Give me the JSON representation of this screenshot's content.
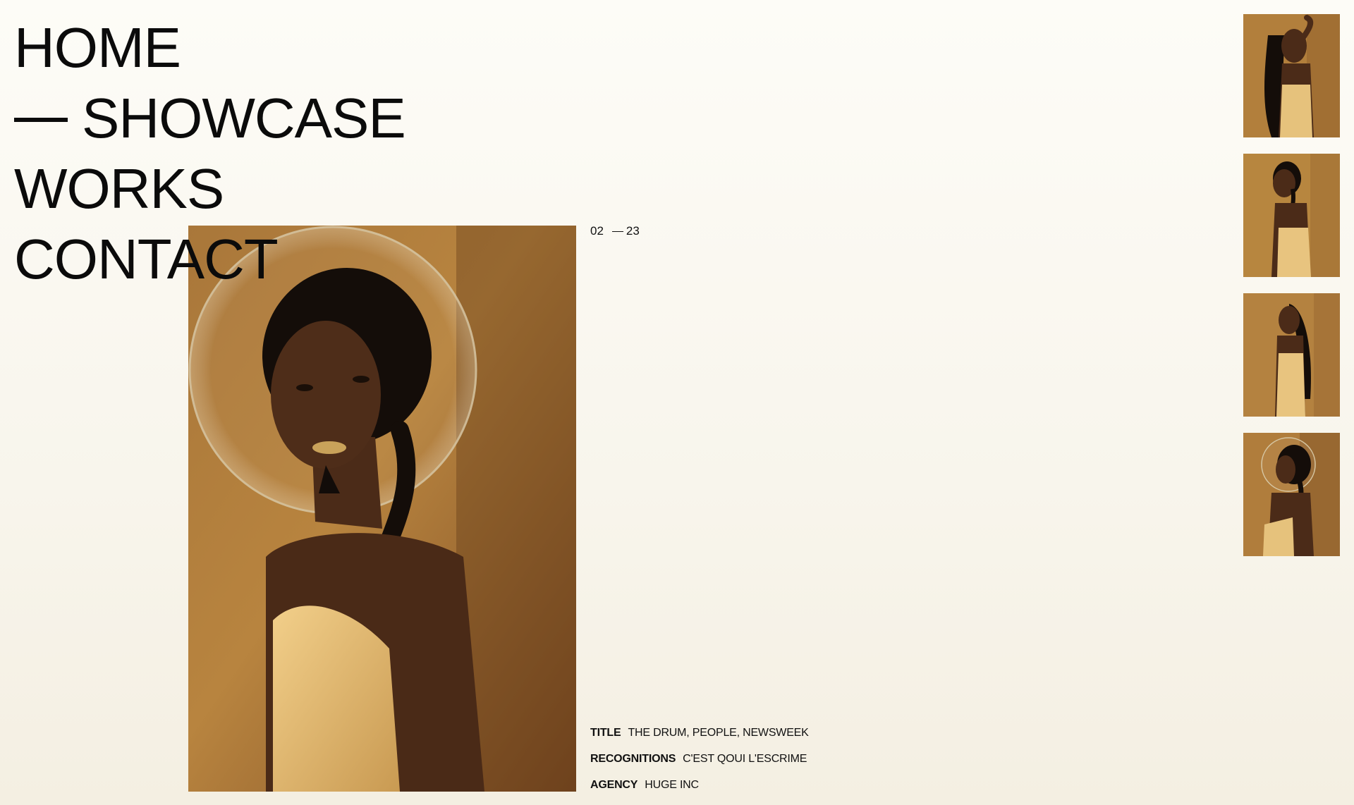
{
  "nav": {
    "items": [
      {
        "label": "HOME",
        "has_dash": false
      },
      {
        "label": "SHOWCASE",
        "has_dash": true
      },
      {
        "label": "WORKS",
        "has_dash": false
      },
      {
        "label": "CONTACT",
        "has_dash": false
      }
    ]
  },
  "counter": {
    "current": "02",
    "total": "23"
  },
  "meta": {
    "title_label": "TITLE",
    "title_value": "THE DRUM, PEOPLE, NEWSWEEK",
    "recognitions_label": "RECOGNITIONS",
    "recognitions_value": "C'EST QOUI L'ESCRIME",
    "agency_label": "AGENCY",
    "agency_value": "HUGE INC"
  },
  "colors": {
    "background": "#fdfcf7",
    "text": "#0b0b0b",
    "photo_backdrop": "#b07f3e",
    "dress": "#e8c07a",
    "skin": "#4a2a17",
    "hair": "#120c09"
  },
  "thumbnails": [
    {
      "icon": "portrait-thumbnail"
    },
    {
      "icon": "portrait-thumbnail"
    },
    {
      "icon": "portrait-thumbnail"
    },
    {
      "icon": "portrait-thumbnail"
    }
  ]
}
